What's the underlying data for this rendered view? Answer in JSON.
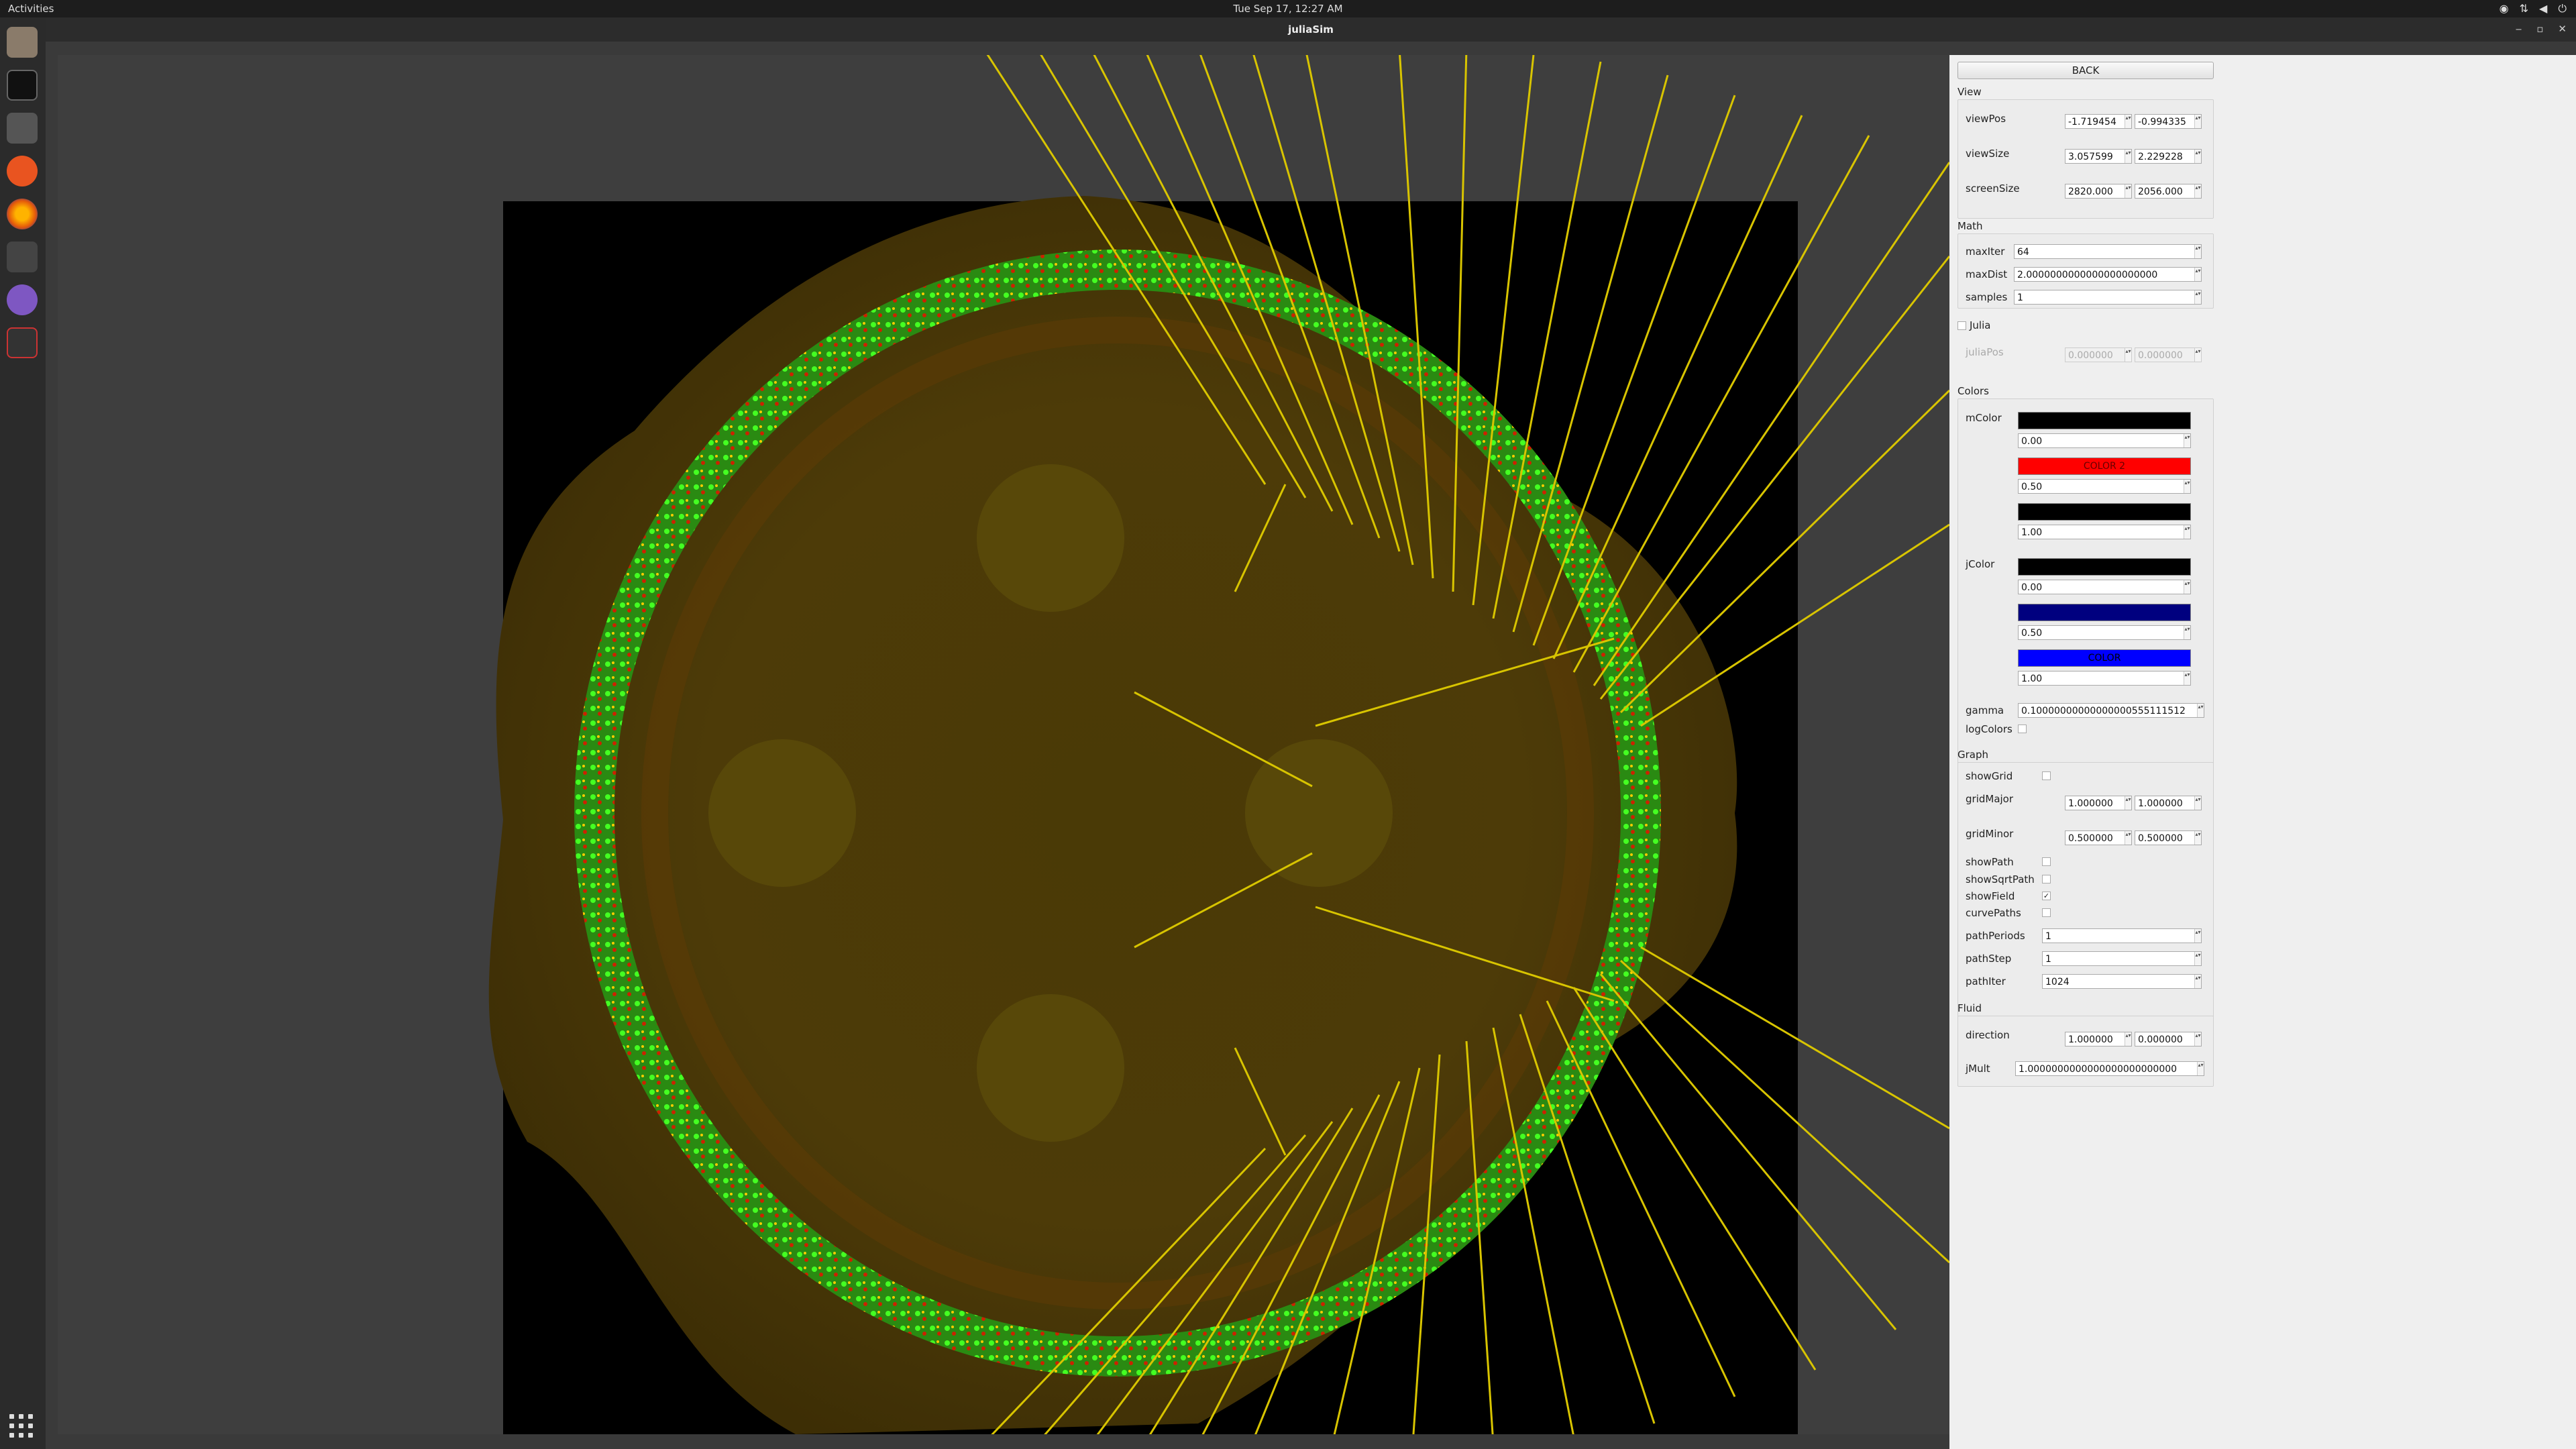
{
  "topbar": {
    "activities": "Activities",
    "clock": "Tue Sep 17, 12:27 AM"
  },
  "window": {
    "title": "juliaSim"
  },
  "panel": {
    "back": "BACK",
    "view": {
      "title": "View",
      "viewPos": {
        "label": "viewPos",
        "x": "-1.719454",
        "y": "-0.994335"
      },
      "viewSize": {
        "label": "viewSize",
        "x": "3.057599",
        "y": "2.229228"
      },
      "screenSize": {
        "label": "screenSize",
        "x": "2820.000",
        "y": "2056.000"
      }
    },
    "math": {
      "title": "Math",
      "maxIter": {
        "label": "maxIter",
        "value": "64"
      },
      "maxDist": {
        "label": "maxDist",
        "value": "2.0000000000000000000000"
      },
      "samples": {
        "label": "samples",
        "value": "1"
      }
    },
    "julia": {
      "label": "Julia",
      "checked": false,
      "juliaPos": {
        "label": "juliaPos",
        "x": "0.000000",
        "y": "0.000000"
      }
    },
    "colors": {
      "title": "Colors",
      "mColor": {
        "label": "mColor",
        "stops": [
          {
            "color": "#000000",
            "text": "",
            "pos": "0.00"
          },
          {
            "color": "#ff0000",
            "text": "COLOR 2",
            "pos": "0.50"
          },
          {
            "color": "#000000",
            "text": "",
            "pos": "1.00"
          }
        ]
      },
      "jColor": {
        "label": "jColor",
        "stops": [
          {
            "color": "#000000",
            "text": "",
            "pos": "0.00"
          },
          {
            "color": "#00007f",
            "text": "",
            "pos": "0.50"
          },
          {
            "color": "#0000ff",
            "text": "COLOR",
            "pos": "1.00"
          }
        ]
      },
      "gamma": {
        "label": "gamma",
        "value": "0.10000000000000000555111512"
      },
      "logColors": {
        "label": "logColors",
        "checked": false
      }
    },
    "graph": {
      "title": "Graph",
      "showGrid": {
        "label": "showGrid",
        "checked": false
      },
      "gridMajor": {
        "label": "gridMajor",
        "x": "1.000000",
        "y": "1.000000"
      },
      "gridMinor": {
        "label": "gridMinor",
        "x": "0.500000",
        "y": "0.500000"
      },
      "showPath": {
        "label": "showPath",
        "checked": false
      },
      "showSqrtPath": {
        "label": "showSqrtPath",
        "checked": false
      },
      "showField": {
        "label": "showField",
        "checked": true
      },
      "curvePaths": {
        "label": "curvePaths",
        "checked": false
      },
      "pathPeriods": {
        "label": "pathPeriods",
        "value": "1"
      },
      "pathStep": {
        "label": "pathStep",
        "value": "1"
      },
      "pathIter": {
        "label": "pathIter",
        "value": "1024"
      }
    },
    "fluid": {
      "title": "Fluid",
      "direction": {
        "label": "direction",
        "x": "1.000000",
        "y": "0.000000"
      },
      "jMult": {
        "label": "jMult",
        "value": "1.0000000000000000000000000"
      }
    }
  },
  "checkmark": "✓",
  "spin": "▴▾"
}
